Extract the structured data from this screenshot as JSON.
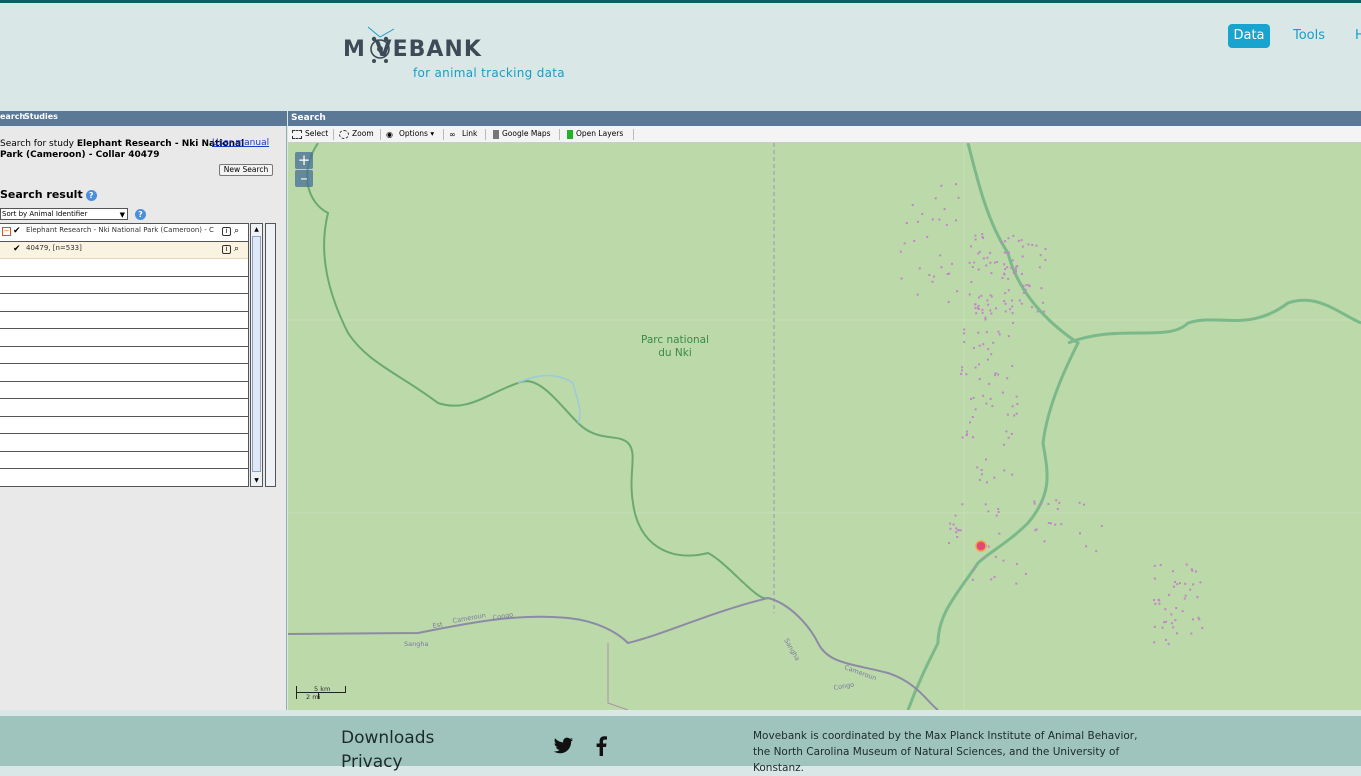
{
  "header": {
    "logo_word": "M VEBANK",
    "logo_tagline": "for animal tracking data",
    "nav": {
      "data": "Data",
      "tools": "Tools",
      "h": "H"
    }
  },
  "left_panel": {
    "tabs": {
      "search": "earch",
      "studies": "Studies"
    },
    "search_prefix": "Search for study",
    "study_name": "Elephant Research - Nki National Park (Cameroon) - Collar 40479",
    "user_manual": "User manual",
    "new_search": "New Search",
    "result_title": "Search result",
    "sort_value": "Sort by Animal Identifier",
    "rows": [
      {
        "label": "Elephant Research - Nki National Park (Cameroon) - C"
      },
      {
        "label": "40479, [n=533]"
      }
    ]
  },
  "map": {
    "title": "Search",
    "toolbar": {
      "select": "Select",
      "zoom": "Zoom",
      "options": "Options",
      "link": "Link",
      "google_maps": "Google Maps",
      "open_layers": "Open Layers"
    },
    "zoom_in": "+",
    "zoom_out": "–",
    "park_label_line1": "Parc national",
    "park_label_line2": "du Nki",
    "road_labels": [
      "Est",
      "Cameroun",
      "Congo",
      "Sangha",
      "Sangha",
      "Cameroun",
      "Congo"
    ],
    "scale_km": "5 km",
    "scale_mi": "2 mi",
    "colors": {
      "land": "#bcd9a9",
      "points": "#c285c9",
      "highlight": "#e0487a"
    }
  },
  "footer": {
    "downloads": "Downloads",
    "privacy": "Privacy",
    "about": "Movebank is coordinated by the Max Planck Institute of Animal Behavior, the North Carolina Museum of Natural Sciences, and the University of Konstanz."
  }
}
